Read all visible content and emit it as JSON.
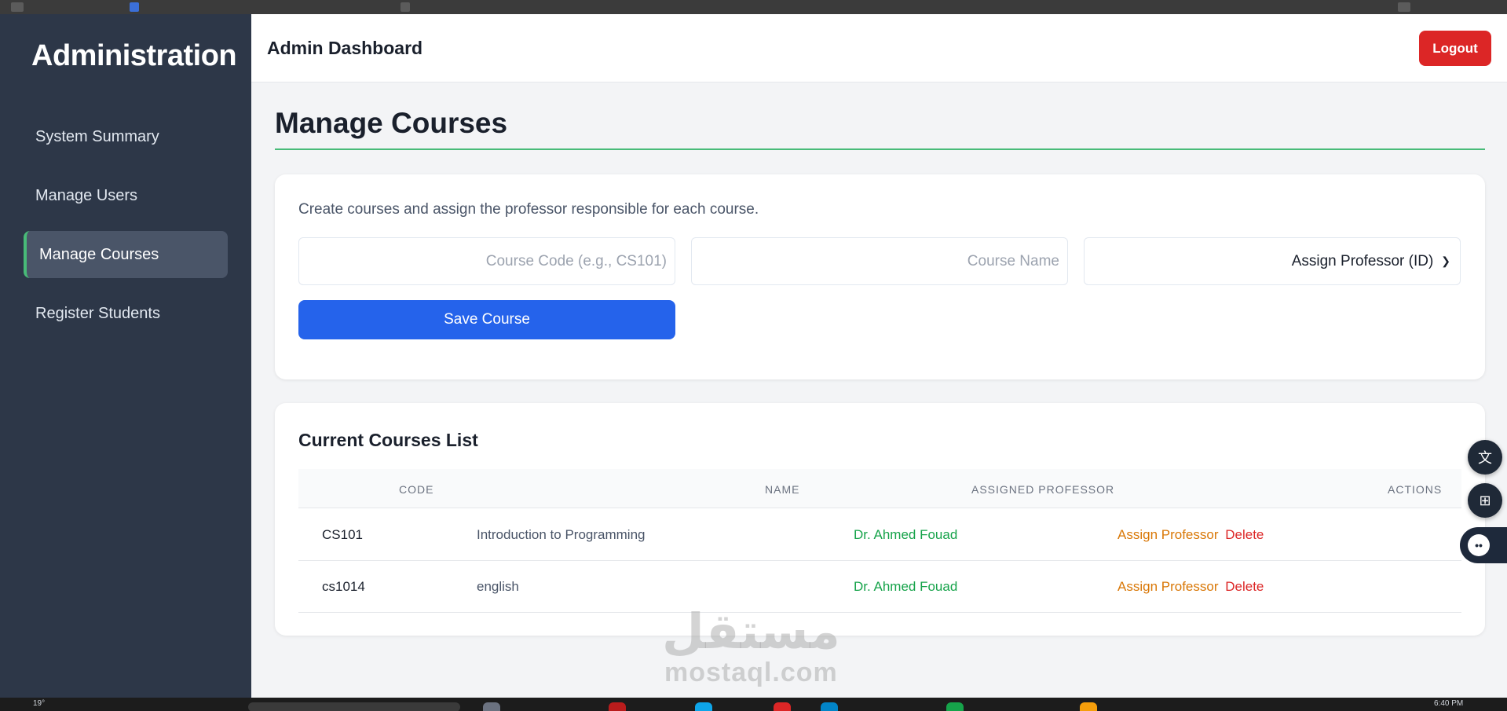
{
  "sidebar": {
    "brand": "Administration",
    "items": [
      {
        "label": "System Summary",
        "active": false
      },
      {
        "label": "Manage Users",
        "active": false
      },
      {
        "label": "Manage Courses",
        "active": true
      },
      {
        "label": "Register Students",
        "active": false
      }
    ]
  },
  "header": {
    "title": "Admin Dashboard",
    "logout_label": "Logout"
  },
  "main": {
    "page_title": "Manage Courses",
    "form": {
      "description": "Create courses and assign the professor responsible for each course.",
      "course_code_placeholder": "Course Code (e.g., CS101)",
      "course_name_placeholder": "Course Name",
      "professor_select_value": "Assign Professor (ID)",
      "save_label": "Save Course"
    },
    "list": {
      "title": "Current Courses List",
      "columns": [
        "CODE",
        "NAME",
        "ASSIGNED PROFESSOR",
        "ACTIONS"
      ],
      "rows": [
        {
          "code": "CS101",
          "name": "Introduction to Programming",
          "professor": "Dr. Ahmed Fouad",
          "assign_label": "Assign Professor",
          "delete_label": "Delete"
        },
        {
          "code": "cs1014",
          "name": "english",
          "professor": "Dr. Ahmed Fouad",
          "assign_label": "Assign Professor",
          "delete_label": "Delete"
        }
      ]
    }
  },
  "floating_tools": [
    "translate-icon",
    "apps-icon",
    "assistant-icon"
  ],
  "watermark": {
    "arabic": "مستقل",
    "latin": "mostaql.com"
  },
  "taskbar": {
    "temperature": "19°",
    "clock": "6:40 PM"
  },
  "colors": {
    "sidebar_bg": "#2d3748",
    "accent_green": "#48bb78",
    "primary_blue": "#2563eb",
    "danger_red": "#dc2626",
    "warning_amber": "#d97706",
    "professor_green": "#16a34a"
  }
}
